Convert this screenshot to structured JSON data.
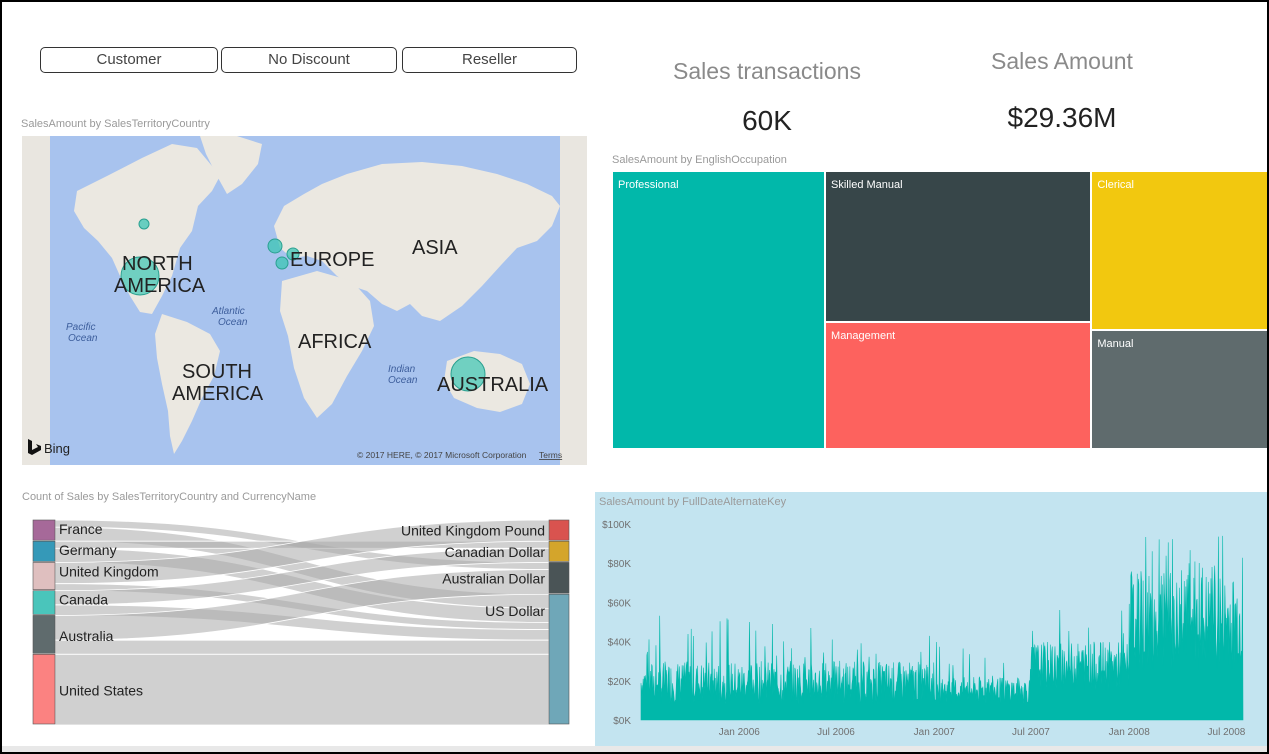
{
  "slicers": [
    "Customer",
    "No Discount",
    "Reseller"
  ],
  "cards": {
    "transactions": {
      "label": "Sales transactions",
      "value": "60K"
    },
    "amount": {
      "label": "Sales Amount",
      "value": "$29.36M"
    }
  },
  "map": {
    "title": "SalesAmount by SalesTerritoryCountry",
    "continents": {
      "north_america": [
        "NORTH",
        "AMERICA"
      ],
      "europe": "EUROPE",
      "asia": "ASIA",
      "africa": "AFRICA",
      "south_america": [
        "SOUTH",
        "AMERICA"
      ],
      "australia": "AUSTRALIA"
    },
    "oceans": {
      "atlantic": [
        "Atlantic",
        "Ocean"
      ],
      "pacific": [
        "Pacific",
        "Ocean"
      ],
      "indian": [
        "Indian",
        "Ocean"
      ]
    },
    "bing": "Bing",
    "copyright": "© 2017 HERE, © 2017 Microsoft Corporation",
    "terms": "Terms",
    "bubble_color": "#3cc6b4"
  },
  "treemap": {
    "title": "SalesAmount by EnglishOccupation"
  },
  "sankey": {
    "title": "Count of Sales by SalesTerritoryCountry and CurrencyName"
  },
  "line": {
    "title": "SalesAmount by FullDateAlternateKey"
  },
  "chart_data": [
    {
      "type": "treemap",
      "title": "SalesAmount by EnglishOccupation",
      "categories": [
        "Professional",
        "Skilled Manual",
        "Management",
        "Clerical",
        "Manual"
      ],
      "colors": [
        "#01b8aa",
        "#374649",
        "#fd625e",
        "#f2c80f",
        "#5f6b6d"
      ],
      "values": [
        9.52,
        6.48,
        5.42,
        4.53,
        3.41
      ]
    },
    {
      "type": "sankey",
      "title": "Count of Sales by SalesTerritoryCountry and CurrencyName",
      "sources": [
        {
          "name": "France",
          "color": "#a66999"
        },
        {
          "name": "Germany",
          "color": "#3599b8"
        },
        {
          "name": "United Kingdom",
          "color": "#dfbfbf"
        },
        {
          "name": "Canada",
          "color": "#4ac5bb"
        },
        {
          "name": "Australia",
          "color": "#5f6b6d"
        },
        {
          "name": "United States",
          "color": "#fb8281"
        }
      ],
      "targets": [
        {
          "name": "United Kingdom Pound",
          "color": "#d9534f"
        },
        {
          "name": "Canadian Dollar",
          "color": "#d4a52b"
        },
        {
          "name": "Australian Dollar",
          "color": "#4a5456"
        },
        {
          "name": "US Dollar",
          "color": "#6fa7b8"
        }
      ],
      "flows": [
        {
          "source": "France",
          "target": "US Dollar",
          "value": 2
        },
        {
          "source": "France",
          "target": "Australian Dollar",
          "value": 1
        },
        {
          "source": "Germany",
          "target": "US Dollar",
          "value": 2
        },
        {
          "source": "Germany",
          "target": "Canadian Dollar",
          "value": 1
        },
        {
          "source": "United Kingdom",
          "target": "United Kingdom Pound",
          "value": 3
        },
        {
          "source": "United Kingdom",
          "target": "US Dollar",
          "value": 1
        },
        {
          "source": "Canada",
          "target": "Canadian Dollar",
          "value": 2
        },
        {
          "source": "Canada",
          "target": "US Dollar",
          "value": 1.5
        },
        {
          "source": "Australia",
          "target": "Australian Dollar",
          "value": 3.5
        },
        {
          "source": "Australia",
          "target": "US Dollar",
          "value": 2
        },
        {
          "source": "United States",
          "target": "US Dollar",
          "value": 10
        }
      ]
    },
    {
      "type": "area",
      "title": "SalesAmount by FullDateAlternateKey",
      "xlim": [
        "2005-07-01",
        "2008-08-01"
      ],
      "x_ticks": [
        "Jan 2006",
        "Jul 2006",
        "Jan 2007",
        "Jul 2007",
        "Jan 2008",
        "Jul 2008"
      ],
      "y_ticks": [
        "$0K",
        "$20K",
        "$40K",
        "$60K",
        "$80K",
        "$100K"
      ],
      "ylim": [
        0,
        100000
      ],
      "color": "#01b8aa",
      "segments": [
        {
          "from": "2005-07-01",
          "to": "2006-12-31",
          "low": 8000,
          "high": 30000,
          "max": 55000
        },
        {
          "from": "2007-01-01",
          "to": "2007-06-30",
          "low": 8000,
          "high": 22000,
          "max": 40000
        },
        {
          "from": "2007-07-01",
          "to": "2007-12-31",
          "low": 15000,
          "high": 40000,
          "max": 58000
        },
        {
          "from": "2008-01-01",
          "to": "2008-07-31",
          "low": 25000,
          "high": 75000,
          "max": 96000
        },
        {
          "from": "2008-08-01",
          "to": "2008-08-01",
          "low": 1000,
          "high": 1500,
          "max": 2000
        }
      ]
    }
  ]
}
